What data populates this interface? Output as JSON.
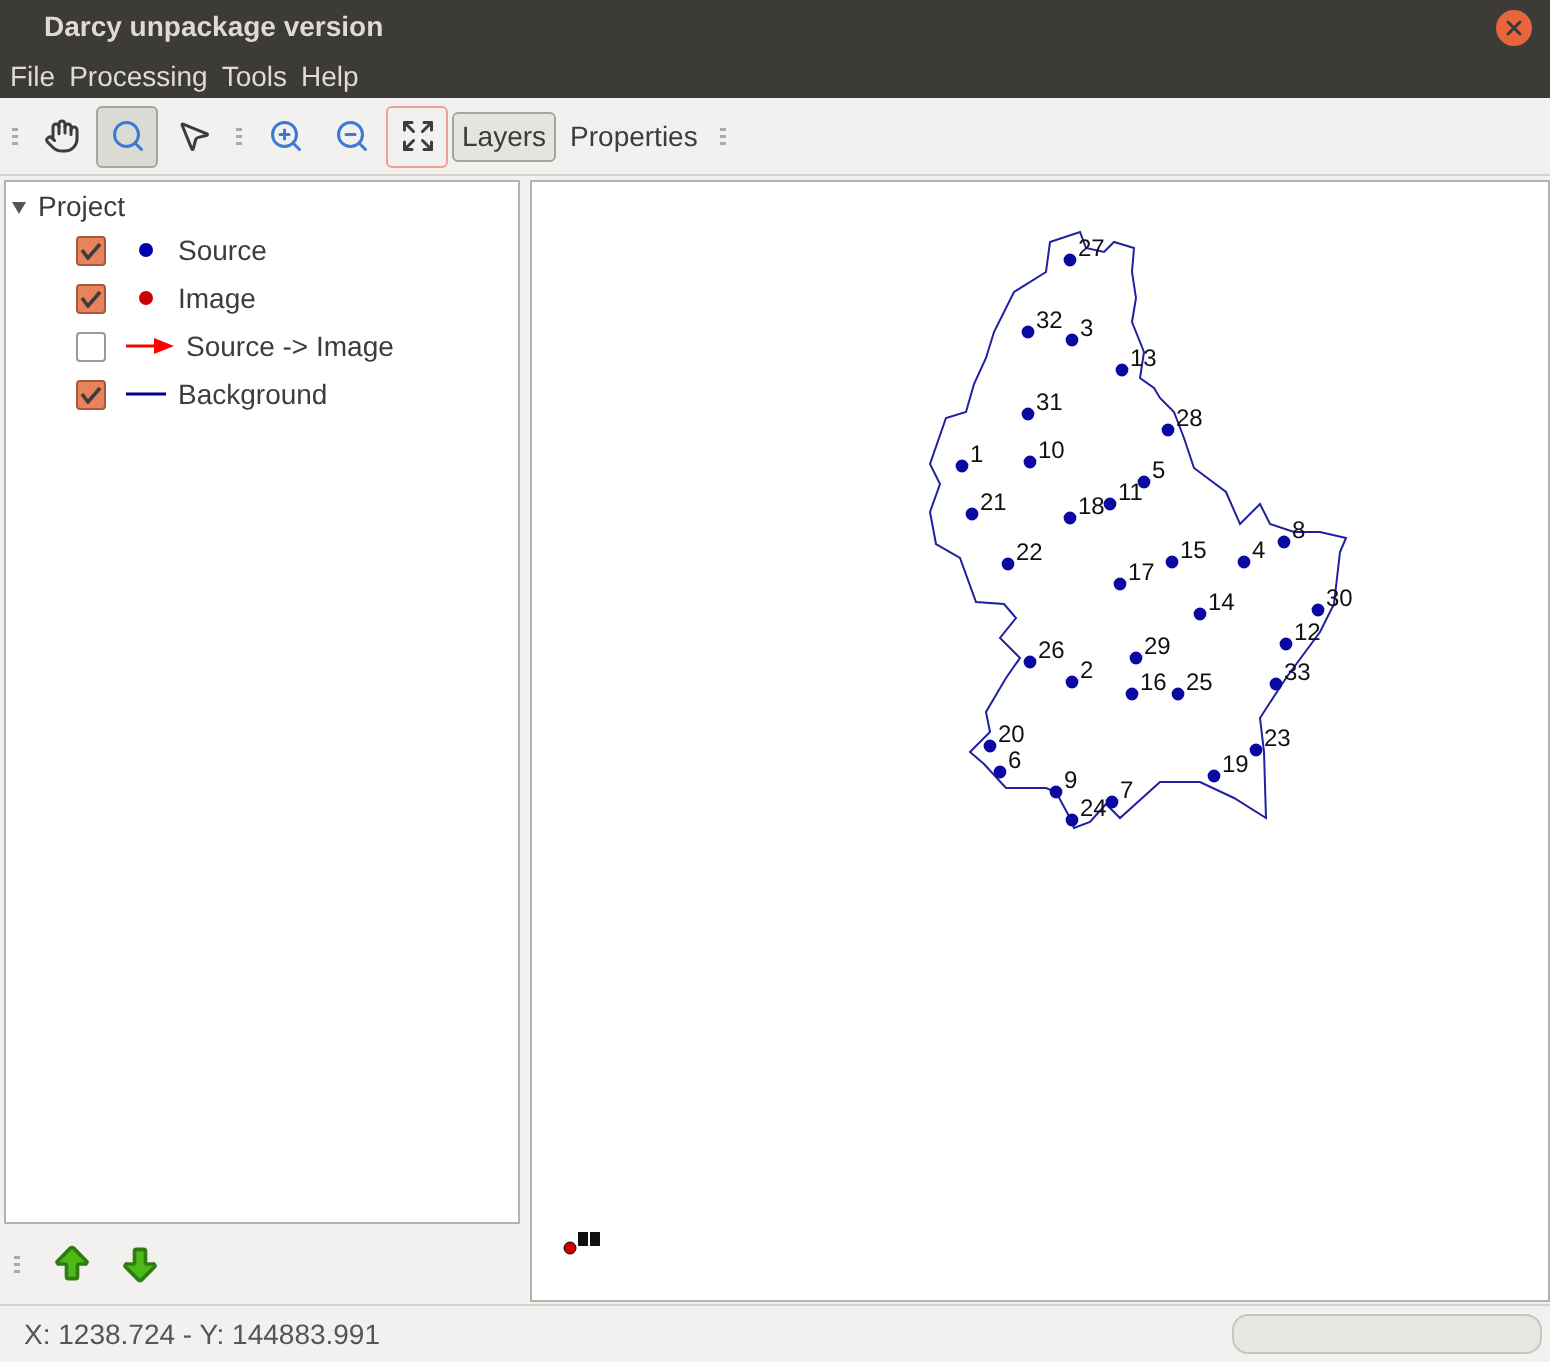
{
  "window": {
    "title": "Darcy unpackage version"
  },
  "menu": [
    "File",
    "Processing",
    "Tools",
    "Help"
  ],
  "toolbar": {
    "tools": [
      {
        "kind": "pan",
        "selected": false,
        "focused": false
      },
      {
        "kind": "zoom",
        "selected": true,
        "focused": false
      },
      {
        "kind": "pointer",
        "selected": false,
        "focused": false
      },
      {
        "kind": "zoom-in",
        "selected": false,
        "focused": false
      },
      {
        "kind": "zoom-out",
        "selected": false,
        "focused": false
      },
      {
        "kind": "extent",
        "selected": false,
        "focused": true
      }
    ],
    "tabs": [
      {
        "label": "Layers",
        "selected": true
      },
      {
        "label": "Properties",
        "selected": false
      }
    ]
  },
  "layers": {
    "label": "Project",
    "expanded": true,
    "children": [
      {
        "label": "Source",
        "checked": true,
        "kind": "point",
        "color": "#0000aa"
      },
      {
        "label": "Image",
        "checked": true,
        "kind": "point",
        "color": "#cc0000"
      },
      {
        "label": "Source -> Image",
        "checked": false,
        "kind": "arrow",
        "color": "#ff0000"
      },
      {
        "label": "Background",
        "checked": true,
        "kind": "line",
        "color": "#000080"
      }
    ]
  },
  "map": {
    "points": [
      {
        "label": "27"
      },
      {
        "label": "32"
      },
      {
        "label": "3"
      },
      {
        "label": "13"
      },
      {
        "label": "31"
      },
      {
        "label": "28"
      },
      {
        "label": "1"
      },
      {
        "label": "10"
      },
      {
        "label": "5"
      },
      {
        "label": "11"
      },
      {
        "label": "21"
      },
      {
        "label": "18"
      },
      {
        "label": "22"
      },
      {
        "label": "15"
      },
      {
        "label": "4"
      },
      {
        "label": "8"
      },
      {
        "label": "17"
      },
      {
        "label": "14"
      },
      {
        "label": "30"
      },
      {
        "label": "12"
      },
      {
        "label": "26"
      },
      {
        "label": "29"
      },
      {
        "label": "2"
      },
      {
        "label": "16"
      },
      {
        "label": "25"
      },
      {
        "label": "33"
      },
      {
        "label": "20"
      },
      {
        "label": "6"
      },
      {
        "label": "23"
      },
      {
        "label": "19"
      },
      {
        "label": "9"
      },
      {
        "label": "7"
      },
      {
        "label": "24"
      }
    ]
  },
  "status_bar": {
    "coordinates": "X: 1238.724 - Y: 144883.991",
    "progress": {
      "level": 0
    }
  }
}
